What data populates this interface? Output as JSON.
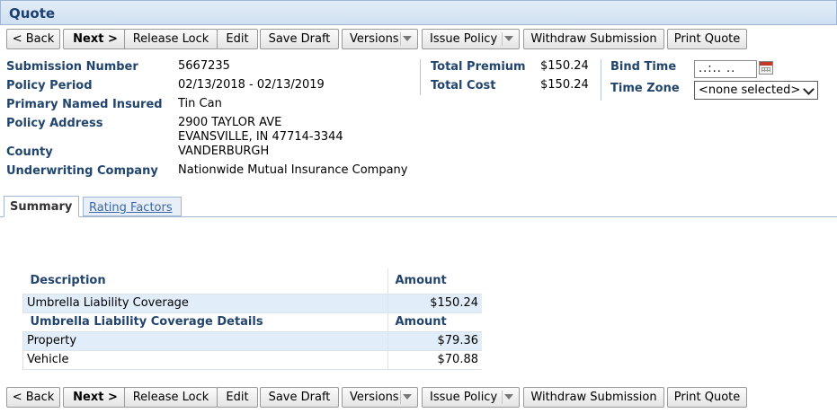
{
  "title": "Quote",
  "toolbar": {
    "back": "< Back",
    "next": "Next >",
    "release_lock": "Release Lock",
    "edit": "Edit",
    "save_draft": "Save Draft",
    "versions": "Versions",
    "issue_policy": "Issue Policy",
    "withdraw": "Withdraw Submission",
    "print_quote": "Print Quote"
  },
  "info": {
    "submission_number_label": "Submission Number",
    "submission_number": "5667235",
    "policy_period_label": "Policy Period",
    "policy_period": "02/13/2018 - 02/13/2019",
    "primary_insured_label": "Primary Named Insured",
    "primary_insured": "Tin Can",
    "policy_address_label": "Policy Address",
    "address_line1": "2900 TAYLOR AVE",
    "address_line2": "EVANSVILLE, IN 47714-3344",
    "county_label": "County",
    "county": "VANDERBURGH",
    "underwriting_label": "Underwriting Company",
    "underwriting": "Nationwide Mutual Insurance Company"
  },
  "totals": {
    "total_premium_label": "Total Premium",
    "total_premium": "$150.24",
    "total_cost_label": "Total Cost",
    "total_cost": "$150.24"
  },
  "bind": {
    "bind_time_label": "Bind Time",
    "bind_time_value": "..:.. ..",
    "time_zone_label": "Time Zone",
    "time_zone_value": "<none selected>"
  },
  "tabs": {
    "summary": "Summary",
    "rating_factors": "Rating Factors"
  },
  "table": {
    "col_description": "Description",
    "col_amount": "Amount",
    "row1_desc": "Umbrella Liability Coverage",
    "row1_amount": "$150.24",
    "details_header": "Umbrella Liability Coverage Details",
    "details_amount_header": "Amount",
    "row2_desc": "Property",
    "row2_amount": "$79.36",
    "row3_desc": "Vehicle",
    "row3_amount": "$70.88"
  },
  "colors": {
    "label": "#22456e",
    "title_bg": "#cfe0f2",
    "highlight_row": "#e1eefa"
  }
}
